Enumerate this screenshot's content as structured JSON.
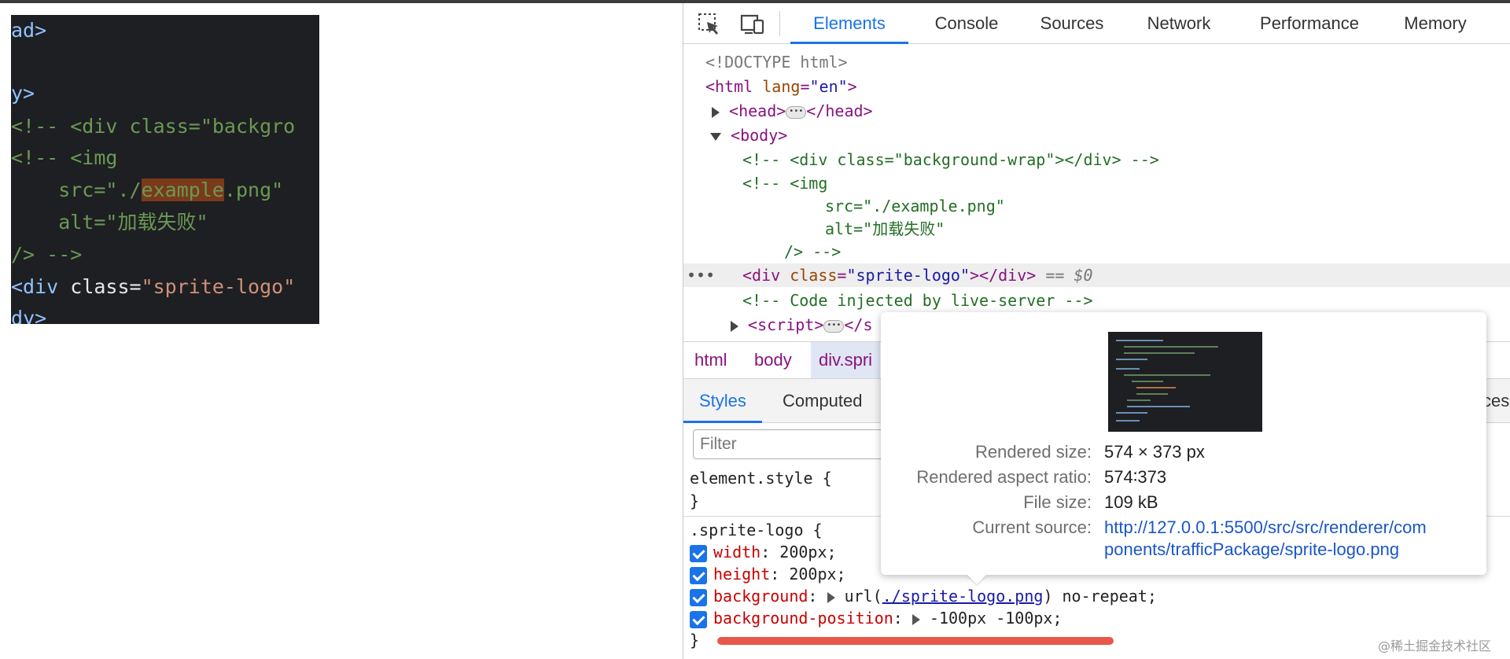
{
  "editor": {
    "lines": [
      {
        "a": "ad>",
        "b": "",
        "c": ""
      },
      {
        "a": "",
        "b": "",
        "c": ""
      },
      {
        "a": "y>",
        "b": "",
        "c": ""
      }
    ],
    "line_comment_div": "<!-- <div class=\"backgro",
    "line_comment_img": "<!-- <img",
    "line_src_pre": "    src=\"./",
    "line_src_hl": "example",
    "line_src_post": ".png\"",
    "line_alt": "    alt=\"加载失败\"",
    "line_close": "/> -->",
    "line_div_tag": "<div",
    "line_div_attr": " class=",
    "line_div_val": "\"sprite-logo\"",
    "line_last": "dy>"
  },
  "devtools": {
    "tabs": [
      "Elements",
      "Console",
      "Sources",
      "Network",
      "Performance",
      "Memory"
    ],
    "active_tab": "Elements",
    "dom": {
      "doctype": "<!DOCTYPE html>",
      "html_open_tag": "<html",
      "html_lang_attr": " lang",
      "html_lang_val": "\"en\"",
      "html_close": ">",
      "head_open": "<head>",
      "head_close": "</head>",
      "body_open": "<body>",
      "comment_bg": "<!-- <div class=\"background-wrap\"></div> -->",
      "comment_img": "<!-- <img",
      "comment_src": "src=\"./example.png\"",
      "comment_alt": "alt=\"加载失败\"",
      "comment_end": "/> -->",
      "sel_tag_open": "<div",
      "sel_attr": " class",
      "sel_val": "\"sprite-logo\"",
      "sel_tag_close": "></div>",
      "sel_marker": " == ",
      "sel_var": "$0",
      "comment_live": "<!-- Code injected by live-server -->",
      "script_open": "<script>",
      "script_close_partial": "</s",
      "left_dots": "•••"
    },
    "breadcrumbs": [
      "html",
      "body",
      "div.spri"
    ],
    "subtabs": [
      "Styles",
      "Computed"
    ],
    "subtab_partial": "ces",
    "filter_placeholder": "Filter",
    "styles": {
      "element_style": "element.style {",
      "close_brace": "}",
      "rule_selector": ".sprite-logo {",
      "props": [
        {
          "name": "width",
          "value": ": 200px;"
        },
        {
          "name": "height",
          "value": ": 200px;"
        },
        {
          "name": "background",
          "value_pre": ": ",
          "func": "url(",
          "link": "./sprite-logo.png",
          "value_post": ") no-repeat;"
        },
        {
          "name": "background-position",
          "value_pre": ": ",
          "value": "-100px -100px;"
        }
      ]
    }
  },
  "tooltip": {
    "rendered_size_label": "Rendered size:",
    "rendered_size_value": "574 × 373 px",
    "aspect_label": "Rendered aspect ratio:",
    "aspect_value": "574∶373",
    "file_size_label": "File size:",
    "file_size_value": "109 kB",
    "source_label": "Current source:",
    "source_line1": "http://127.0.0.1:5500/src/src/renderer/com",
    "source_line2": "ponents/trafficPackage/sprite-logo.png"
  },
  "watermark": "@稀土掘金技术社区",
  "colors": {
    "accent": "#1a73e8",
    "tag": "#881280",
    "attr": "#994500",
    "value": "#1a1aa6",
    "comment": "#236e25",
    "css_prop": "#c80000",
    "highlight_bar": "#e8584a"
  }
}
